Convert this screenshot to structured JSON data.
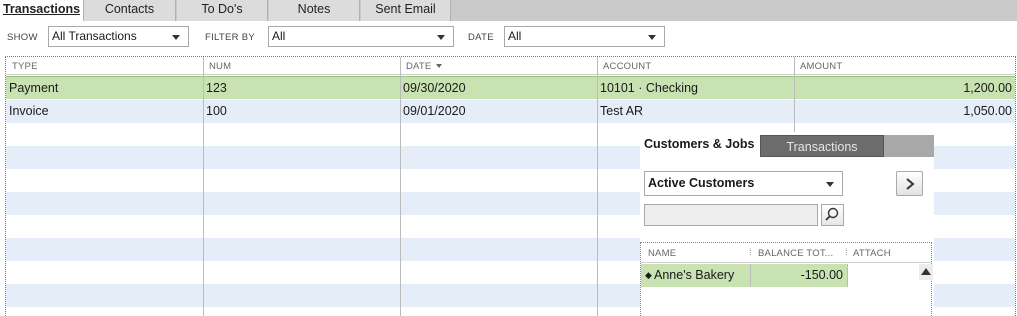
{
  "tabs": [
    {
      "label": "Transactions"
    },
    {
      "label": "Contacts"
    },
    {
      "label": "To Do's"
    },
    {
      "label": "Notes"
    },
    {
      "label": "Sent Email"
    }
  ],
  "filters": {
    "show_label": "SHOW",
    "show_value": "All Transactions",
    "filter_by_label": "FILTER BY",
    "filter_by_value": "All",
    "date_label": "DATE",
    "date_value": "All"
  },
  "table": {
    "columns": [
      "TYPE",
      "NUM",
      "DATE",
      "ACCOUNT",
      "AMOUNT"
    ],
    "rows": [
      {
        "type": "Payment",
        "num": "123",
        "date": "09/30/2020",
        "account": "10101 · Checking",
        "amount": "1,200.00"
      },
      {
        "type": "Invoice",
        "num": "100",
        "date": "09/01/2020",
        "account": "Test AR",
        "amount": "1,050.00"
      }
    ]
  },
  "panel": {
    "tab_customers": "Customers & Jobs",
    "tab_transactions": "Transactions",
    "dropdown_value": "Active Customers",
    "search_value": "",
    "list_columns": [
      "NAME",
      "BALANCE TOT...",
      "ATTACH"
    ],
    "list_rows": [
      {
        "name": "Anne's Bakery",
        "balance": "-150.00"
      }
    ]
  },
  "colors": {
    "selected_row": "#c8e2b2",
    "alt_row": "#e5eef8",
    "inactive_tab": "#6c6c6c"
  }
}
